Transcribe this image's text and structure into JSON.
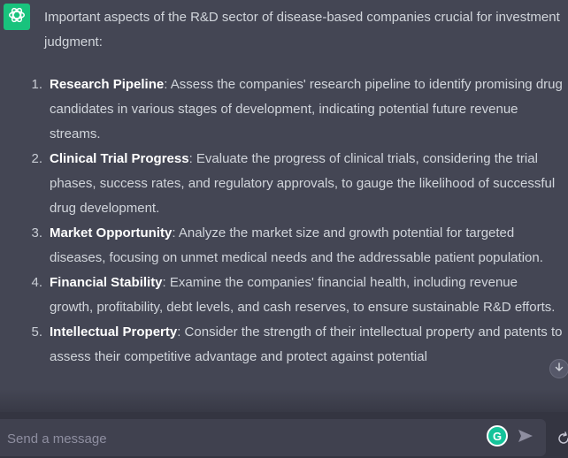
{
  "message": {
    "intro": "Important aspects of the R&D sector of disease-based companies crucial for investment judgment:",
    "points": [
      {
        "number": "1.",
        "term": "Research Pipeline",
        "text": ": Assess the companies' research pipeline to identify promising drug candidates in various stages of development, indicating potential future revenue streams."
      },
      {
        "number": "2.",
        "term": "Clinical Trial Progress",
        "text": ": Evaluate the progress of clinical trials, considering the trial phases, success rates, and regulatory approvals, to gauge the likelihood of successful drug development."
      },
      {
        "number": "3.",
        "term": "Market Opportunity",
        "text": ": Analyze the market size and growth potential for targeted diseases, focusing on unmet medical needs and the addressable patient population."
      },
      {
        "number": "4.",
        "term": "Financial Stability",
        "text": ": Examine the companies' financial health, including revenue growth, profitability, debt levels, and cash reserves, to ensure sustainable R&D efforts."
      },
      {
        "number": "5.",
        "term": "Intellectual Property",
        "text": ": Consider the strength of their intellectual property and patents to assess their competitive advantage and protect against potential"
      }
    ]
  },
  "composer": {
    "placeholder": "Send a message"
  },
  "grammarly": {
    "letter": "G"
  },
  "icons": {
    "avatar": "openai-logo-icon",
    "scroll": "arrow-down-icon",
    "send": "send-icon",
    "regenerate": "refresh-icon"
  },
  "colors": {
    "background": "#444654",
    "composer": "#40414f",
    "avatar": "#19c37d",
    "grammarly": "#15c39a",
    "text": "#d1d5db"
  }
}
